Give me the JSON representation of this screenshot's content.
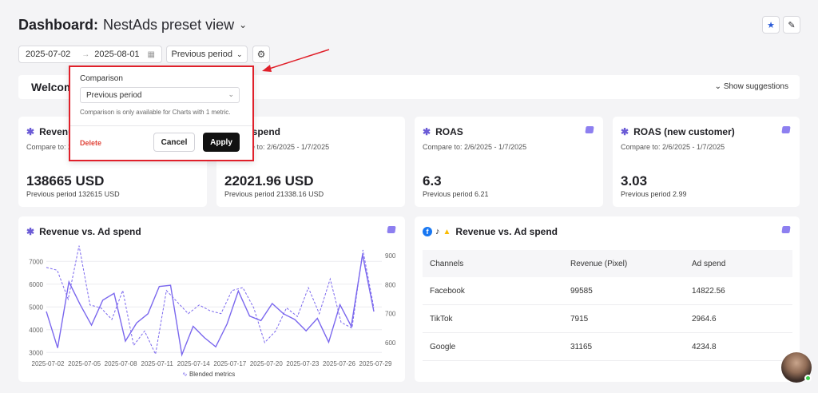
{
  "header": {
    "title": "Dashboard:",
    "view_name": "NestAds preset view"
  },
  "filters": {
    "date_from": "2025-07-02",
    "date_to": "2025-08-01",
    "comparison": "Previous period"
  },
  "welcome": {
    "title": "Welcom",
    "show_suggestions": "Show suggestions"
  },
  "popup": {
    "label": "Comparison",
    "selected": "Previous period",
    "note": "Comparison is only available for Charts with 1 metric.",
    "delete": "Delete",
    "cancel": "Cancel",
    "apply": "Apply"
  },
  "kpis": [
    {
      "title": "Revenue",
      "compare": "Compare to: 2/",
      "value": "138665 USD",
      "previous": "Previous period 132615 USD"
    },
    {
      "title": "l spend",
      "compare": "re to: 2/6/2025 - 1/7/2025",
      "value": "22021.96 USD",
      "previous": "Previous period 21338.16 USD"
    },
    {
      "title": "ROAS",
      "compare": "Compare to: 2/6/2025 - 1/7/2025",
      "value": "6.3",
      "previous": "Previous period 6.21"
    },
    {
      "title": "ROAS (new customer)",
      "compare": "Compare to: 2/6/2025 - 1/7/2025",
      "value": "3.03",
      "previous": "Previous period 2.99"
    }
  ],
  "chart_card": {
    "title": "Revenue vs. Ad spend",
    "legend": "Blended metrics"
  },
  "chart_data": {
    "type": "line",
    "x_ticks": [
      "2025-07-02",
      "2025-07-05",
      "2025-07-08",
      "2025-07-11",
      "2025-07-14",
      "2025-07-17",
      "2025-07-20",
      "2025-07-23",
      "2025-07-26",
      "2025-07-29"
    ],
    "y_left_ticks": [
      3000,
      4000,
      5000,
      6000,
      7000
    ],
    "y_right_ticks": [
      600,
      700,
      800,
      900
    ],
    "y_left_lim": [
      2800,
      7500
    ],
    "y_right_lim": [
      550,
      920
    ],
    "series": [
      {
        "values": [
          4800,
          3200,
          6100,
          5100,
          4200,
          5300,
          5600,
          3500,
          4300,
          4700,
          5900,
          5950,
          2900,
          4150,
          3650,
          3250,
          4250,
          5700,
          4600,
          4400,
          5150,
          4700,
          4450,
          3950,
          4500,
          3450,
          5100,
          4150,
          7300,
          4800
        ]
      },
      {
        "values": [
          860,
          850,
          750,
          935,
          730,
          720,
          680,
          780,
          590,
          640,
          560,
          780,
          740,
          700,
          730,
          710,
          700,
          780,
          790,
          720,
          600,
          640,
          720,
          690,
          790,
          700,
          820,
          670,
          650,
          920,
          720
        ]
      }
    ]
  },
  "table_card": {
    "title": "Revenue vs. Ad spend",
    "columns": [
      "Channels",
      "Revenue (Pixel)",
      "Ad spend"
    ],
    "rows": [
      [
        "Facebook",
        "99585",
        "14822.56"
      ],
      [
        "TikTok",
        "7915",
        "2964.6"
      ],
      [
        "Google",
        "31165",
        "4234.8"
      ]
    ]
  },
  "colors": {
    "accent": "#7b68ee",
    "highlight": "#e0202a"
  }
}
